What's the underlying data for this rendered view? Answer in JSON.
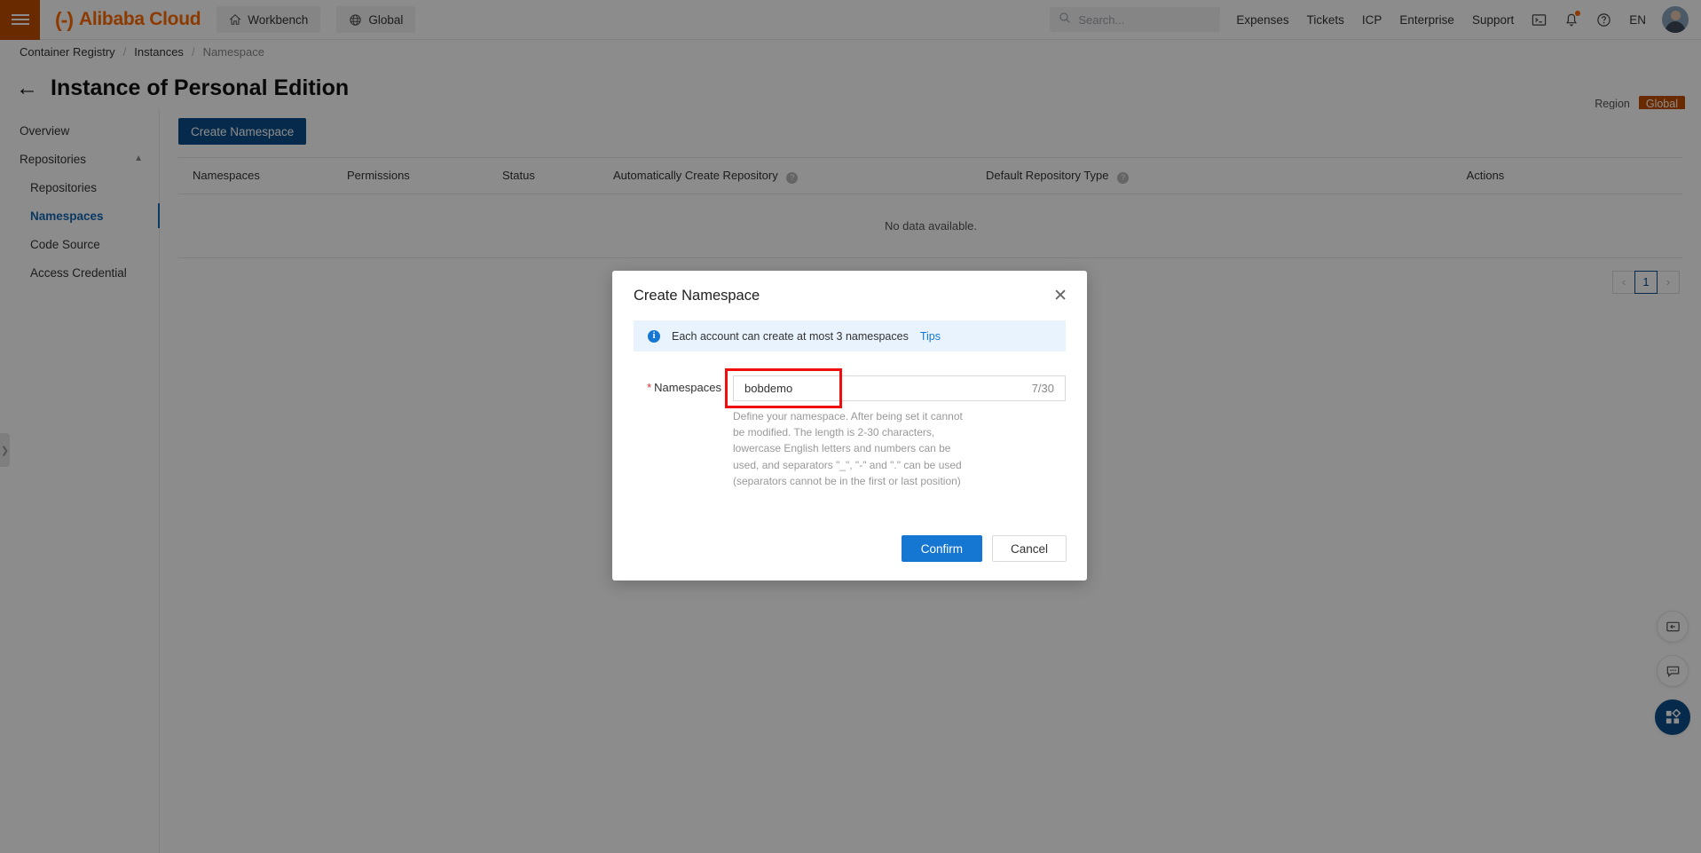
{
  "header": {
    "menu_icon": "hamburger-icon",
    "brand_mark": "(-)",
    "brand_name": "Alibaba Cloud",
    "workbench_label": "Workbench",
    "workbench_icon": "home-icon",
    "global_label": "Global",
    "global_icon": "globe-icon",
    "search_placeholder": "Search...",
    "search_value": "",
    "search_icon": "search-icon",
    "links": [
      "Expenses",
      "Tickets",
      "ICP",
      "Enterprise",
      "Support"
    ],
    "console_icon": "terminal-icon",
    "bell_icon": "bell-icon",
    "help_icon": "question-circle-icon",
    "language": "EN",
    "avatar": "user-avatar"
  },
  "breadcrumb": {
    "items": [
      {
        "label": "Container Registry",
        "current": false
      },
      {
        "label": "Instances",
        "current": false
      },
      {
        "label": "Namespace",
        "current": true
      }
    ],
    "separator": "/"
  },
  "page": {
    "back_icon": "arrow-left-icon",
    "title": "Instance of Personal Edition",
    "region_label": "Region",
    "region_value": "Global"
  },
  "sidebar": {
    "items": [
      {
        "label": "Overview",
        "level": "top",
        "active": false,
        "expandable": false
      },
      {
        "label": "Repositories",
        "level": "top",
        "active": false,
        "expandable": true,
        "chevron": "chevron-up-icon"
      },
      {
        "label": "Repositories",
        "level": "sub",
        "active": false,
        "expandable": false
      },
      {
        "label": "Namespaces",
        "level": "sub",
        "active": true,
        "expandable": false
      },
      {
        "label": "Code Source",
        "level": "sub",
        "active": false,
        "expandable": false
      },
      {
        "label": "Access Credential",
        "level": "sub",
        "active": false,
        "expandable": false
      }
    ],
    "collapse_handle_icon": "chevron-right-icon"
  },
  "main": {
    "create_button": "Create Namespace",
    "table": {
      "columns": [
        {
          "label": "Namespaces",
          "help": false
        },
        {
          "label": "Permissions",
          "help": false
        },
        {
          "label": "Status",
          "help": false
        },
        {
          "label": "Automatically Create Repository",
          "help": true,
          "help_icon": "question-icon"
        },
        {
          "label": "Default Repository Type",
          "help": true,
          "help_icon": "question-icon"
        },
        {
          "label": "Actions",
          "help": false
        }
      ],
      "empty_text": "No data available.",
      "rows": []
    },
    "pagination": {
      "prev_icon": "chevron-left-icon",
      "current_page": "1",
      "next_icon": "chevron-right-icon"
    }
  },
  "float_buttons": [
    {
      "name": "feedback-panel-icon",
      "icon": "screen-arrow-icon",
      "accent": false
    },
    {
      "name": "chat-icon",
      "icon": "speech-bubble-icon",
      "accent": false
    },
    {
      "name": "apps-grid-icon",
      "icon": "grid-icon",
      "accent": true
    }
  ],
  "modal": {
    "title": "Create Namespace",
    "close_icon": "close-icon",
    "notice": {
      "icon": "info-icon",
      "text": "Each account can create at most 3 namespaces",
      "link": "Tips"
    },
    "field": {
      "required_mark": "*",
      "label": "Namespaces",
      "value": "bobdemo",
      "placeholder": "",
      "counter": "7/30",
      "helper": "Define your namespace. After being set it cannot be modified. The length is 2-30 characters, lowercase English letters and numbers can be used, and separators \"_\", \"-\" and \".\" can be used (separators cannot be in the first or last position)"
    },
    "confirm_label": "Confirm",
    "cancel_label": "Cancel"
  },
  "colors": {
    "brand_orange": "#ff6a00",
    "menu_orange": "#c24e00",
    "primary_blue": "#1677d2",
    "dark_blue": "#0b4d89",
    "highlight_red": "#f10d0d"
  }
}
